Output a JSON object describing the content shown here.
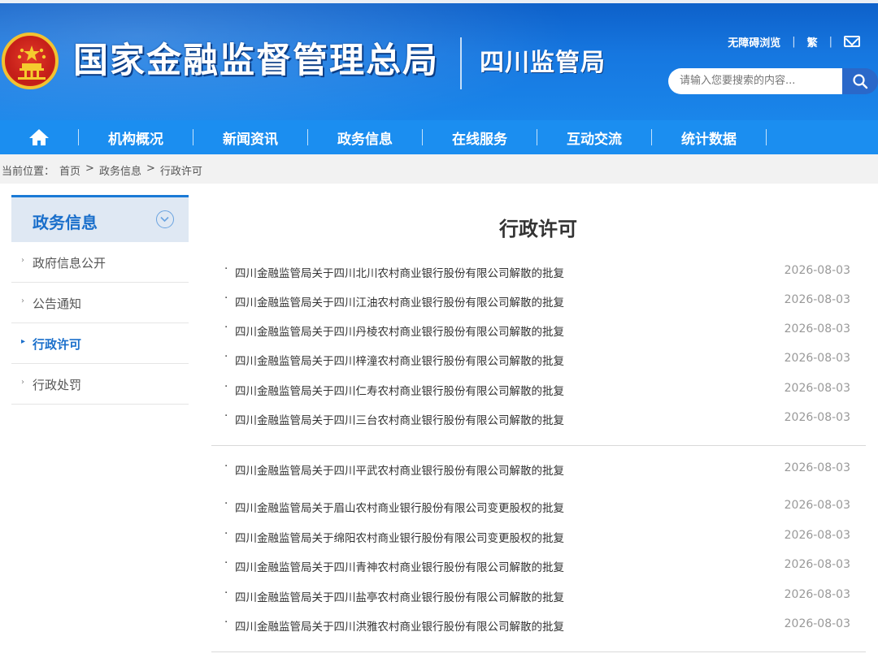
{
  "header": {
    "site_title": "国家金融监督管理总局",
    "sub_title": "四川监管局",
    "util_accessible": "无障碍浏览",
    "util_traditional": "繁",
    "util_sep": "|",
    "search_placeholder": "请输入您要搜索的内容...",
    "brand_color": "#1677e0"
  },
  "nav": {
    "items": [
      {
        "label": "机构概况"
      },
      {
        "label": "新闻资讯"
      },
      {
        "label": "政务信息"
      },
      {
        "label": "在线服务"
      },
      {
        "label": "互动交流"
      },
      {
        "label": "统计数据"
      }
    ]
  },
  "breadcrumb": {
    "prefix": "当前位置：",
    "home": "首页",
    "sep": ">",
    "level1": "政务信息",
    "level2": "行政许可"
  },
  "sidebar": {
    "title": "政务信息",
    "items": [
      {
        "label": "政府信息公开",
        "active": false
      },
      {
        "label": "公告通知",
        "active": false
      },
      {
        "label": "行政许可",
        "active": true
      },
      {
        "label": "行政处罚",
        "active": false
      }
    ]
  },
  "main": {
    "title": "行政许可",
    "bullet": "·",
    "list": [
      {
        "title": "四川金融监管局关于四川北川农村商业银行股份有限公司解散的批复",
        "date": "2026-08-03"
      },
      {
        "title": "四川金融监管局关于四川江油农村商业银行股份有限公司解散的批复",
        "date": "2026-08-03"
      },
      {
        "title": "四川金融监管局关于四川丹棱农村商业银行股份有限公司解散的批复",
        "date": "2026-08-03"
      },
      {
        "title": "四川金融监管局关于四川梓潼农村商业银行股份有限公司解散的批复",
        "date": "2026-08-03"
      },
      {
        "title": "四川金融监管局关于四川仁寿农村商业银行股份有限公司解散的批复",
        "date": "2026-08-03"
      },
      {
        "title": "四川金融监管局关于四川三台农村商业银行股份有限公司解散的批复",
        "date": "2026-08-03"
      },
      {
        "title": "四川金融监管局关于四川平武农村商业银行股份有限公司解散的批复",
        "date": "2026-08-03"
      },
      {
        "title": "四川金融监管局关于眉山农村商业银行股份有限公司变更股权的批复",
        "date": "2026-08-03"
      },
      {
        "title": "四川金融监管局关于绵阳农村商业银行股份有限公司变更股权的批复",
        "date": "2026-08-03"
      },
      {
        "title": "四川金融监管局关于四川青神农村商业银行股份有限公司解散的批复",
        "date": "2026-08-03"
      },
      {
        "title": "四川金融监管局关于四川盐亭农村商业银行股份有限公司解散的批复",
        "date": "2026-08-03"
      },
      {
        "title": "四川金融监管局关于四川洪雅农村商业银行股份有限公司解散的批复",
        "date": "2026-08-03"
      }
    ]
  }
}
